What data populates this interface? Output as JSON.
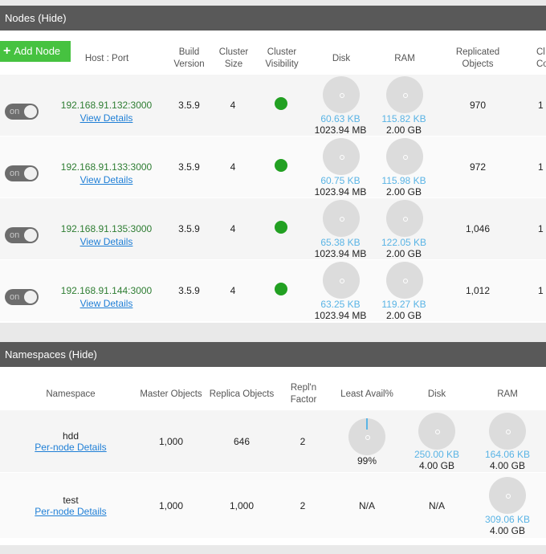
{
  "nodes_panel": {
    "title": "Nodes (Hide)",
    "add_node_label": "Add Node",
    "columns": [
      "Host : Port",
      "Build Version",
      "Cluster Size",
      "Cluster Visibility",
      "Disk",
      "RAM",
      "Replicated Objects",
      "Cl Conn"
    ],
    "rows": [
      {
        "toggle": "on",
        "host": "192.168.91.132:3000",
        "details": "View Details",
        "build": "3.5.9",
        "cluster_size": "4",
        "disk_used": "60.63 KB",
        "disk_total": "1023.94 MB",
        "ram_used": "115.82 KB",
        "ram_total": "2.00 GB",
        "replicated": "970",
        "extra": "1"
      },
      {
        "toggle": "on",
        "host": "192.168.91.133:3000",
        "details": "View Details",
        "build": "3.5.9",
        "cluster_size": "4",
        "disk_used": "60.75 KB",
        "disk_total": "1023.94 MB",
        "ram_used": "115.98 KB",
        "ram_total": "2.00 GB",
        "replicated": "972",
        "extra": "1"
      },
      {
        "toggle": "on",
        "host": "192.168.91.135:3000",
        "details": "View Details",
        "build": "3.5.9",
        "cluster_size": "4",
        "disk_used": "65.38 KB",
        "disk_total": "1023.94 MB",
        "ram_used": "122.05 KB",
        "ram_total": "2.00 GB",
        "replicated": "1,046",
        "extra": "1"
      },
      {
        "toggle": "on",
        "host": "192.168.91.144:3000",
        "details": "View Details",
        "build": "3.5.9",
        "cluster_size": "4",
        "disk_used": "63.25 KB",
        "disk_total": "1023.94 MB",
        "ram_used": "119.27 KB",
        "ram_total": "2.00 GB",
        "replicated": "1,012",
        "extra": "1"
      }
    ]
  },
  "namespaces_panel": {
    "title": "Namespaces (Hide)",
    "columns": [
      "Namespace",
      "Master Objects",
      "Replica Objects",
      "Repl'n Factor",
      "Least Avail%",
      "Disk",
      "RAM"
    ],
    "rows": [
      {
        "name": "hdd",
        "details": "Per-node Details",
        "master": "1,000",
        "replica": "646",
        "factor": "2",
        "least_avail": "99%",
        "disk_used": "250.00 KB",
        "disk_total": "4.00 GB",
        "ram_used": "164.06 KB",
        "ram_total": "4.00 GB"
      },
      {
        "name": "test",
        "details": "Per-node Details",
        "master": "1,000",
        "replica": "1,000",
        "factor": "2",
        "least_avail": "N/A",
        "disk_na": "N/A",
        "ram_used": "309.06 KB",
        "ram_total": "4.00 GB"
      }
    ]
  },
  "colors": {
    "header_bg": "#595959",
    "add_button": "#46c240",
    "visible_dot": "#22a022",
    "used_text": "#5ab4e5",
    "link": "#1f7fd6"
  }
}
